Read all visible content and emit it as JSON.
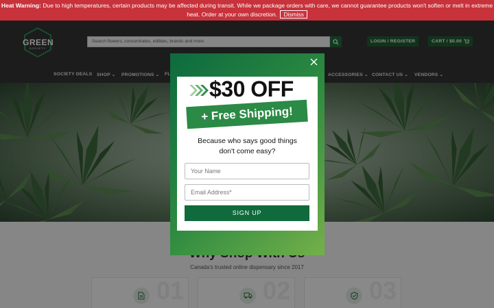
{
  "warning": {
    "label": "Heat Warning:",
    "text": "Due to high temperatures, certain products may be affected during transit. While we package orders with care, we cannot guarantee products won't soften or melt in extreme heat. Order at your own discretion.",
    "dismiss": "Dismiss"
  },
  "header": {
    "logo_main": "GREEN",
    "logo_sub": "SOCIETY",
    "search_placeholder": "Search flowers, concentrates, edibles, brands and more",
    "login": "LOGIN / REGISTER",
    "cart": "CART / $0.00"
  },
  "nav": {
    "items": [
      "SOCIETY DEALS",
      "SHOP",
      "PROMOTIONS",
      "FL",
      "ACCESSORIES",
      "CONTACT US",
      "VENDORS"
    ]
  },
  "section": {
    "title": "Why Shop With Us",
    "subtitle": "Canada's trusted online dispensary since 2017",
    "cards": [
      "01",
      "02",
      "03"
    ]
  },
  "popup": {
    "headline": "$30 OFF",
    "ribbon": "+ Free Shipping!",
    "tagline_line1": "Because who says good things",
    "tagline_line2": "don't come easy?",
    "name_placeholder": "Your Name",
    "email_placeholder": "Email Address*",
    "signup": "SIGN UP"
  },
  "colors": {
    "warning_bg": "#c8323b",
    "brand_green": "#1f5e33",
    "header_bg": "#333333"
  }
}
